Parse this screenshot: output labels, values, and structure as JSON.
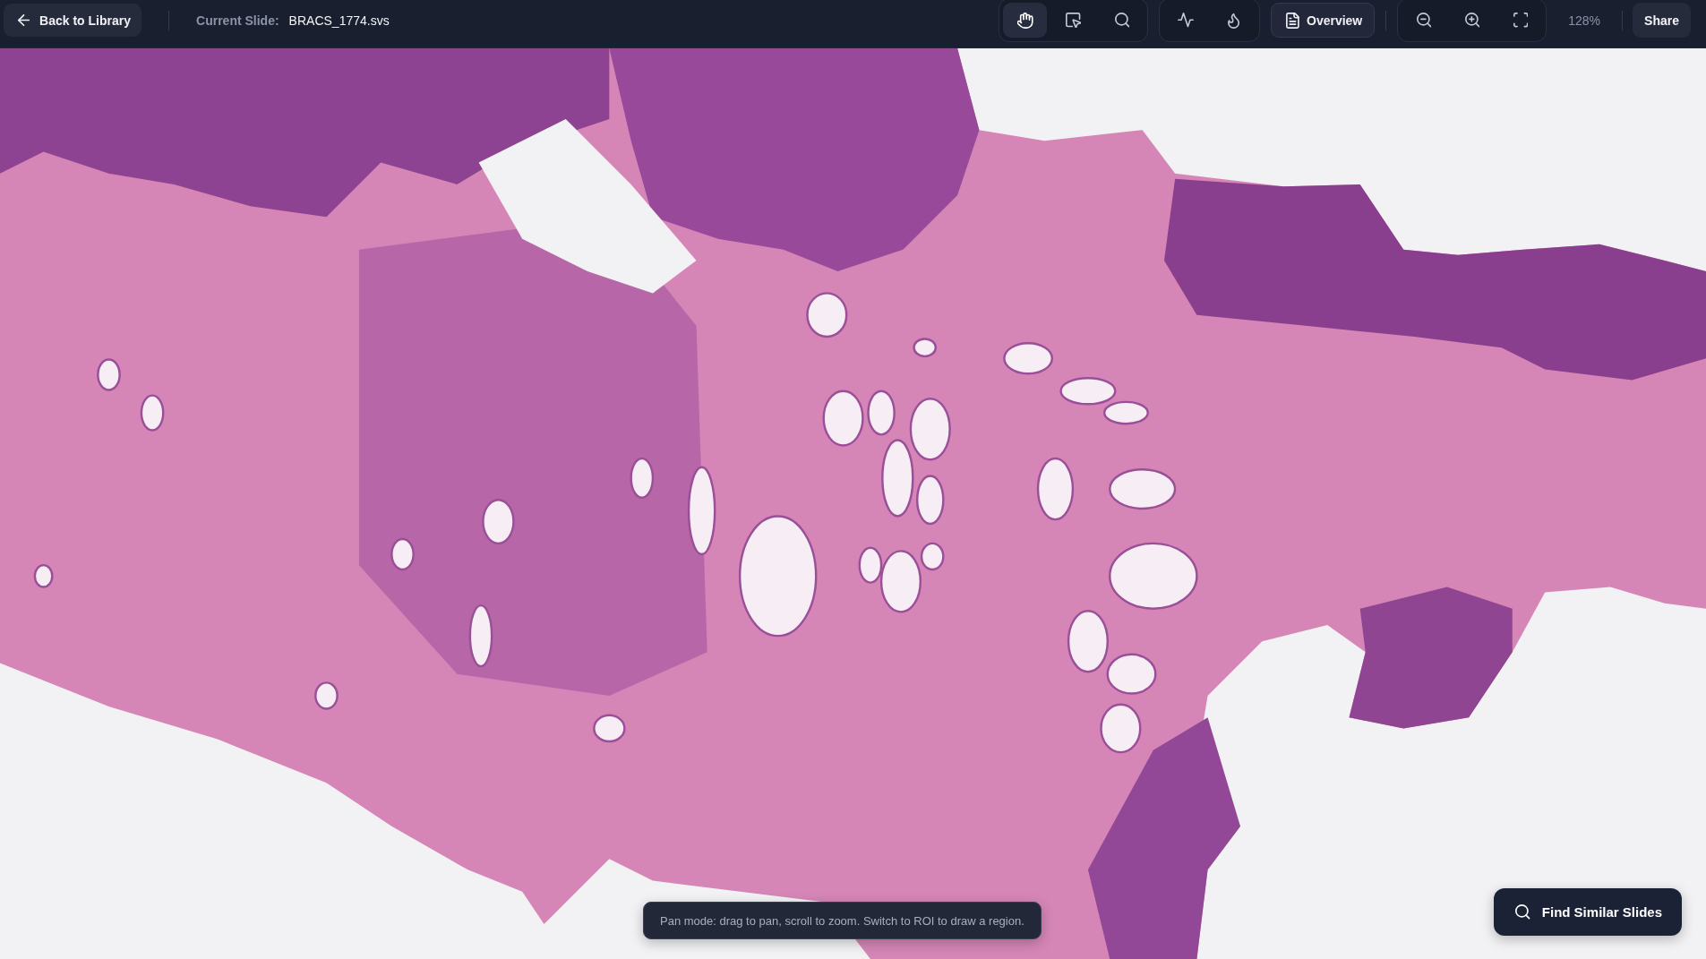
{
  "toolbar": {
    "back_button": {
      "label": "Back to Library"
    },
    "current_slide": {
      "label": "Current Slide:",
      "name": "BRACS_1774.svs"
    },
    "tool_groups": [
      {
        "tools": [
          {
            "kind": "pan",
            "selected": true
          },
          {
            "kind": "roi",
            "selected": false
          },
          {
            "kind": "search",
            "selected": false
          }
        ]
      },
      {
        "tools": [
          {
            "kind": "analysis"
          },
          {
            "kind": "heatmap"
          }
        ]
      }
    ],
    "overview_button": {
      "label": "Overview"
    },
    "zoom_controls": [
      {
        "kind": "zoom_out"
      },
      {
        "kind": "zoom_in"
      },
      {
        "kind": "fit"
      }
    ],
    "zoom_level": "128%",
    "share_button": {
      "label": "Share"
    }
  },
  "viewer": {
    "hint": "Pan mode: drag to pan, scroll to zoom. Switch to ROI to draw a region.",
    "find_button": {
      "label": "Find Similar Slides"
    }
  }
}
